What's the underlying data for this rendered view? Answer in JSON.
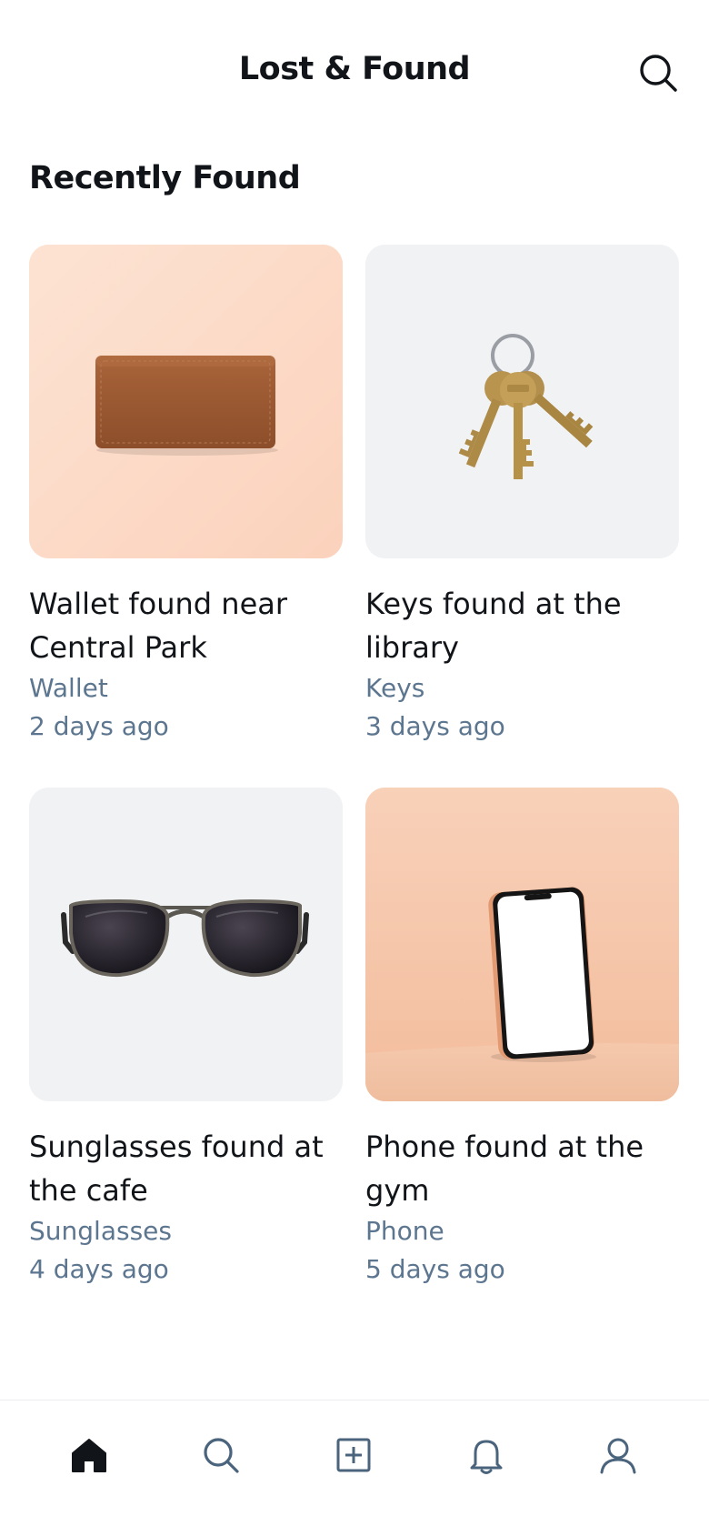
{
  "header": {
    "title": "Lost & Found",
    "search_icon": "search-icon"
  },
  "section": {
    "title": "Recently Found"
  },
  "items": [
    {
      "title_line1": "Wallet found near",
      "title_line2": "Central Park",
      "category": "Wallet",
      "time": "2 days ago",
      "image": "wallet",
      "bg": "#fcdcc9"
    },
    {
      "title_line1": "Keys found at the",
      "title_line2": "library",
      "category": "Keys",
      "time": "3 days ago",
      "image": "keys",
      "bg": "#f1f2f4"
    },
    {
      "title_line1": "Sunglasses found at",
      "title_line2": "the cafe",
      "category": "Sunglasses",
      "time": "4 days ago",
      "image": "sunglasses",
      "bg": "#f1f2f4"
    },
    {
      "title_line1": "Phone found at the",
      "title_line2": "gym",
      "category": "Phone",
      "time": "5 days ago",
      "image": "phone",
      "bg": "#f7c9ad"
    }
  ],
  "nav": {
    "items": [
      {
        "icon": "home-icon",
        "active": true
      },
      {
        "icon": "search-icon",
        "active": false
      },
      {
        "icon": "add-icon",
        "active": false
      },
      {
        "icon": "bell-icon",
        "active": false
      },
      {
        "icon": "profile-icon",
        "active": false
      }
    ]
  },
  "colors": {
    "text_primary": "#111418",
    "text_secondary": "#5d7690",
    "nav_active": "#111418",
    "nav_inactive": "#4b647d"
  }
}
